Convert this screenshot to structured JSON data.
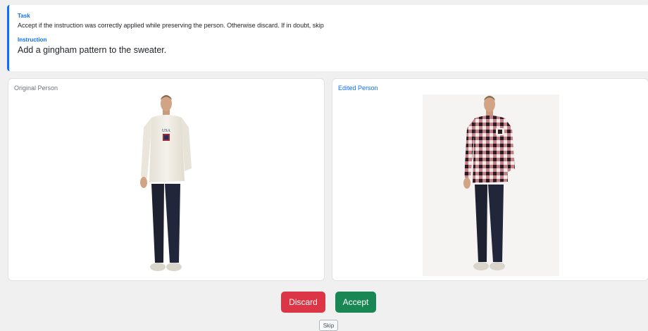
{
  "task": {
    "label": "Task",
    "text": "Accept if the instruction was correctly applied while preserving the person. Otherwise discard. If in doubt, skip"
  },
  "instruction": {
    "label": "Instruction",
    "text": "Add a gingham pattern to the sweater."
  },
  "panels": {
    "original": {
      "title": "Original Person"
    },
    "edited": {
      "title": "Edited Person"
    }
  },
  "buttons": {
    "discard": "Discard",
    "accept": "Accept",
    "skip": "Skip"
  },
  "colors": {
    "primary": "#0d6efd",
    "discard": "#dc3545",
    "accept": "#198754"
  }
}
